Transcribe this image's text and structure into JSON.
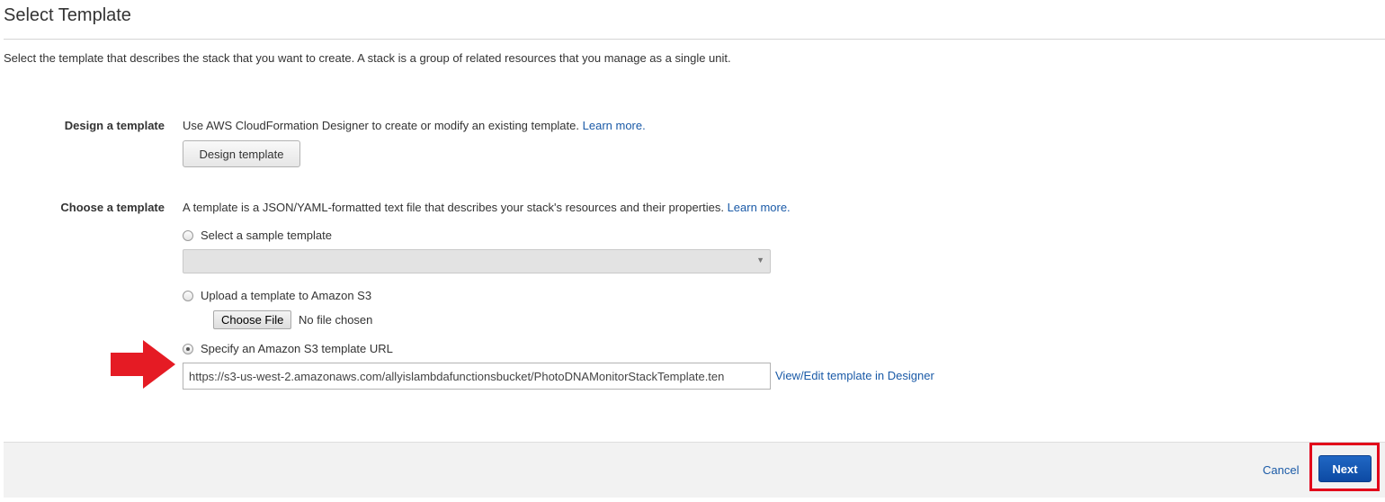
{
  "header": {
    "title": "Select Template",
    "description": "Select the template that describes the stack that you want to create. A stack is a group of related resources that you manage as a single unit."
  },
  "design_section": {
    "label": "Design a template",
    "text": "Use AWS CloudFormation Designer to create or modify an existing template.",
    "learn_more": "Learn more.",
    "button_label": "Design template"
  },
  "choose_section": {
    "label": "Choose a template",
    "text": "A template is a JSON/YAML-formatted text file that describes your stack's resources and their properties.",
    "learn_more": "Learn more.",
    "options": [
      {
        "label": "Select a sample template",
        "selected": false
      },
      {
        "label": "Upload a template to Amazon S3",
        "selected": false
      },
      {
        "label": "Specify an Amazon S3 template URL",
        "selected": true
      }
    ],
    "sample_select_value": "",
    "file_button_label": "Choose File",
    "file_status": "No file chosen",
    "url_value": "https://s3-us-west-2.amazonaws.com/allyislambdafunctionsbucket/PhotoDNAMonitorStackTemplate.ten",
    "designer_link": "View/Edit template in Designer"
  },
  "footer": {
    "cancel_label": "Cancel",
    "next_label": "Next"
  },
  "colors": {
    "link": "#1a5aa7",
    "primary_button": "#1560bd",
    "annotation_red": "#e2001a"
  }
}
